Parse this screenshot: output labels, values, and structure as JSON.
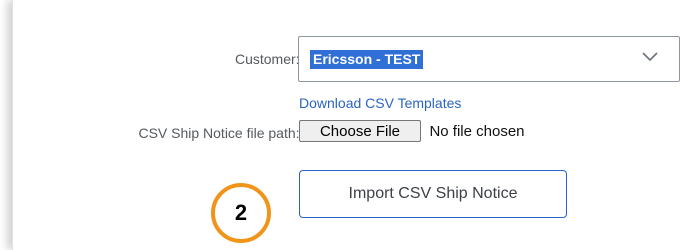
{
  "form": {
    "customer": {
      "label": "Customer:",
      "required_mark": "*",
      "selected_value": "Ericsson - TEST"
    },
    "download_link": "Download CSV Templates",
    "file_path": {
      "label": "CSV Ship Notice file path:",
      "required_mark": "*",
      "choose_button": "Choose File",
      "status": "No file chosen"
    },
    "import_button": "Import CSV Ship Notice"
  },
  "annotation": {
    "step_number": "2",
    "color": "#f0951a"
  },
  "colors": {
    "accent": "#2a64c5",
    "selection_highlight": "#2f6fd6"
  },
  "icons": {
    "dropdown": "chevron-down-icon"
  }
}
